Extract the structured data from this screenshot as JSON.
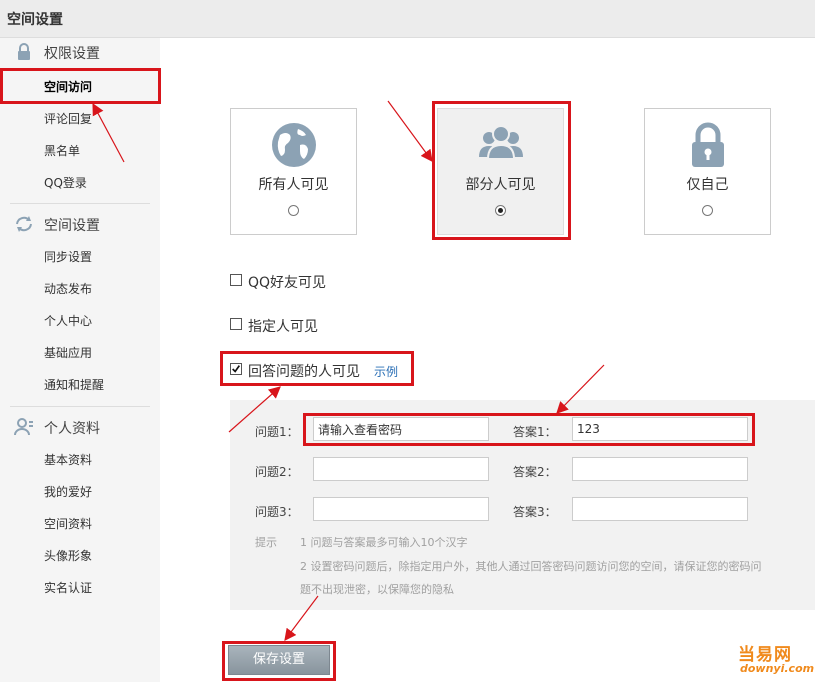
{
  "window": {
    "title": "空间设置"
  },
  "sidebar": {
    "sections": [
      {
        "icon": "lock-icon",
        "label": "权限设置",
        "items": [
          "空间访问",
          "评论回复",
          "黑名单",
          "QQ登录"
        ]
      },
      {
        "icon": "sync-icon",
        "label": "空间设置",
        "items": [
          "同步设置",
          "动态发布",
          "个人中心",
          "基础应用",
          "通知和提醒"
        ]
      },
      {
        "icon": "profile-icon",
        "label": "个人资料",
        "items": [
          "基本资料",
          "我的爱好",
          "空间资料",
          "头像形象",
          "实名认证"
        ]
      }
    ],
    "active_item": "空间访问"
  },
  "visibility": {
    "options": [
      {
        "icon": "globe-icon",
        "label": "所有人可见",
        "selected": false
      },
      {
        "icon": "people-icon",
        "label": "部分人可见",
        "selected": true
      },
      {
        "icon": "padlock-icon",
        "label": "仅自己",
        "selected": false
      }
    ]
  },
  "checkboxes": [
    {
      "label": "QQ好友可见",
      "checked": false
    },
    {
      "label": "指定人可见",
      "checked": false
    },
    {
      "label": "回答问题的人可见",
      "checked": true,
      "link": "示例"
    }
  ],
  "questions": [
    {
      "q_label": "问题1：",
      "q_value": "请输入查看密码",
      "a_label": "答案1：",
      "a_value": "123"
    },
    {
      "q_label": "问题2：",
      "q_value": "",
      "a_label": "答案2：",
      "a_value": ""
    },
    {
      "q_label": "问题3：",
      "q_value": "",
      "a_label": "答案3：",
      "a_value": ""
    }
  ],
  "tips": {
    "label": "提示",
    "line1": "1 问题与答案最多可输入10个汉字",
    "line2": "2 设置密码问题后，除指定用户外，其他人通过回答密码问题访问您的空间，请保证您的密码问",
    "line3": "题不出现泄密，以保障您的隐私"
  },
  "save_button": "保存设置",
  "watermark": {
    "name": "当易网",
    "url": "downyi.com"
  },
  "colors": {
    "highlight": "#d8151b",
    "button": "#98a3ab",
    "link": "#2a6fb6",
    "icon": "#8ca2b4"
  }
}
